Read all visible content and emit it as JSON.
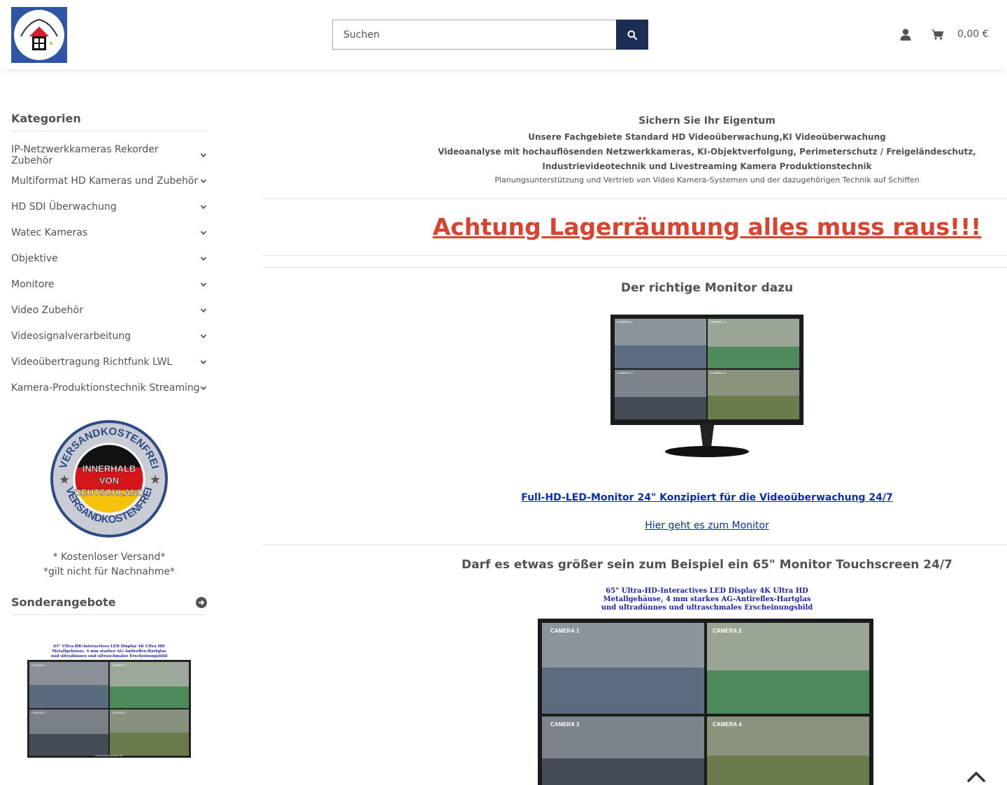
{
  "header": {
    "search_placeholder": "Suchen",
    "cart_total": "0,00 €",
    "icons": [
      "search-icon",
      "user-icon",
      "shopping-cart-icon"
    ],
    "accent_color": "#1c2c53"
  },
  "sidebar": {
    "categories_title": "Kategorien",
    "categories": [
      {
        "label": "IP-Netzwerkkameras Rekorder Zubehör"
      },
      {
        "label": "Multiformat HD Kameras und Zubehör"
      },
      {
        "label": "HD SDI Überwachung"
      },
      {
        "label": "Watec Kameras"
      },
      {
        "label": "Objektive"
      },
      {
        "label": "Monitore"
      },
      {
        "label": "Video Zubehör"
      },
      {
        "label": "Videosignalverarbeitung"
      },
      {
        "label": "Videoübertragung Richtfunk LWL"
      },
      {
        "label": "Kamera-Produktionstechnik Streaming"
      }
    ],
    "badge": {
      "top_text": "VERSANDKOSTENFREI",
      "bottom_text": "VERSANDKOSTENFREI",
      "center_line1": "INNERHALB",
      "center_line2": "VON",
      "center_line3": "DEUTSCHLAND"
    },
    "shipping_line1": "* Kostenloser Versand*",
    "shipping_line2": "*gilt nicht für Nachnahme*",
    "special_offers_title": "Sonderangebote",
    "special_offer_image": {
      "caption_line1": "65\" Ultra-HD-Interactives LED Display 4K Ultra HD",
      "caption_line2": "Metallgehäuse, 4 mm starkes AG-Antireflex-Hartglas",
      "caption_line3": "und ultradünnes und ultraschmales Erscheinungsbild",
      "cam1": "CAMERA 1",
      "cam2": "CAMERA 2",
      "cam3": "CAMERA 3",
      "cam4": "CAMERA 4",
      "footer": "www.alarmvideo.de"
    }
  },
  "main": {
    "intro_title": "Sichern Sie Ihr Eigentum",
    "intro_line1": "Unsere Fachgebiete Standard HD Videoüberwachung,KI Videoüberwachung",
    "intro_line2": "Videoanalyse mit hochauflösenden Netzwerkkameras, KI-Objektverfolgung, Perimeterschutz / Freigeländeschutz,",
    "intro_line3": "Industrievideotechnik und Livestreaming Kamera Produktionstechnik",
    "intro_line4": "Planungsunterstützung und Vertrieb von Video Kamera-Systemen und der dazugehörigen Technik auf Schiffen",
    "alert": "Achtung Lagerräumung alles muss raus!!!",
    "monitor_heading": "Der richtige Monitor dazu",
    "monitor_image": {
      "cam1": "CAMERA 1",
      "cam2": "CAMERA 2",
      "cam3": "CAMERA 3",
      "cam4": "CAMERA 4"
    },
    "monitor_link": "Full-HD-LED-Monitor 24\" Konzipiert für die Videoüberwachung 24/7",
    "monitor_link2": "Hier geht es zum Monitor",
    "large_heading": "Darf es etwas größer sein zum Beispiel ein 65\" Monitor Touchscreen 24/7",
    "large_caption_line1": "65\" Ultra-HD-Interactives LED Display 4K Ultra HD",
    "large_caption_line2": "Metallgehäuse, 4 mm starkes AG-Antireflex-Hartglas",
    "large_caption_line3": "und ultradünnes und ultraschmales Erscheinungsbild",
    "large_image": {
      "cam1": "CAMERA 1",
      "cam2": "CAMERA 2",
      "cam3": "CAMERA 3",
      "cam4": "CAMERA 4"
    },
    "alert_color": "#d9442f",
    "link_color": "#0b2db0"
  }
}
